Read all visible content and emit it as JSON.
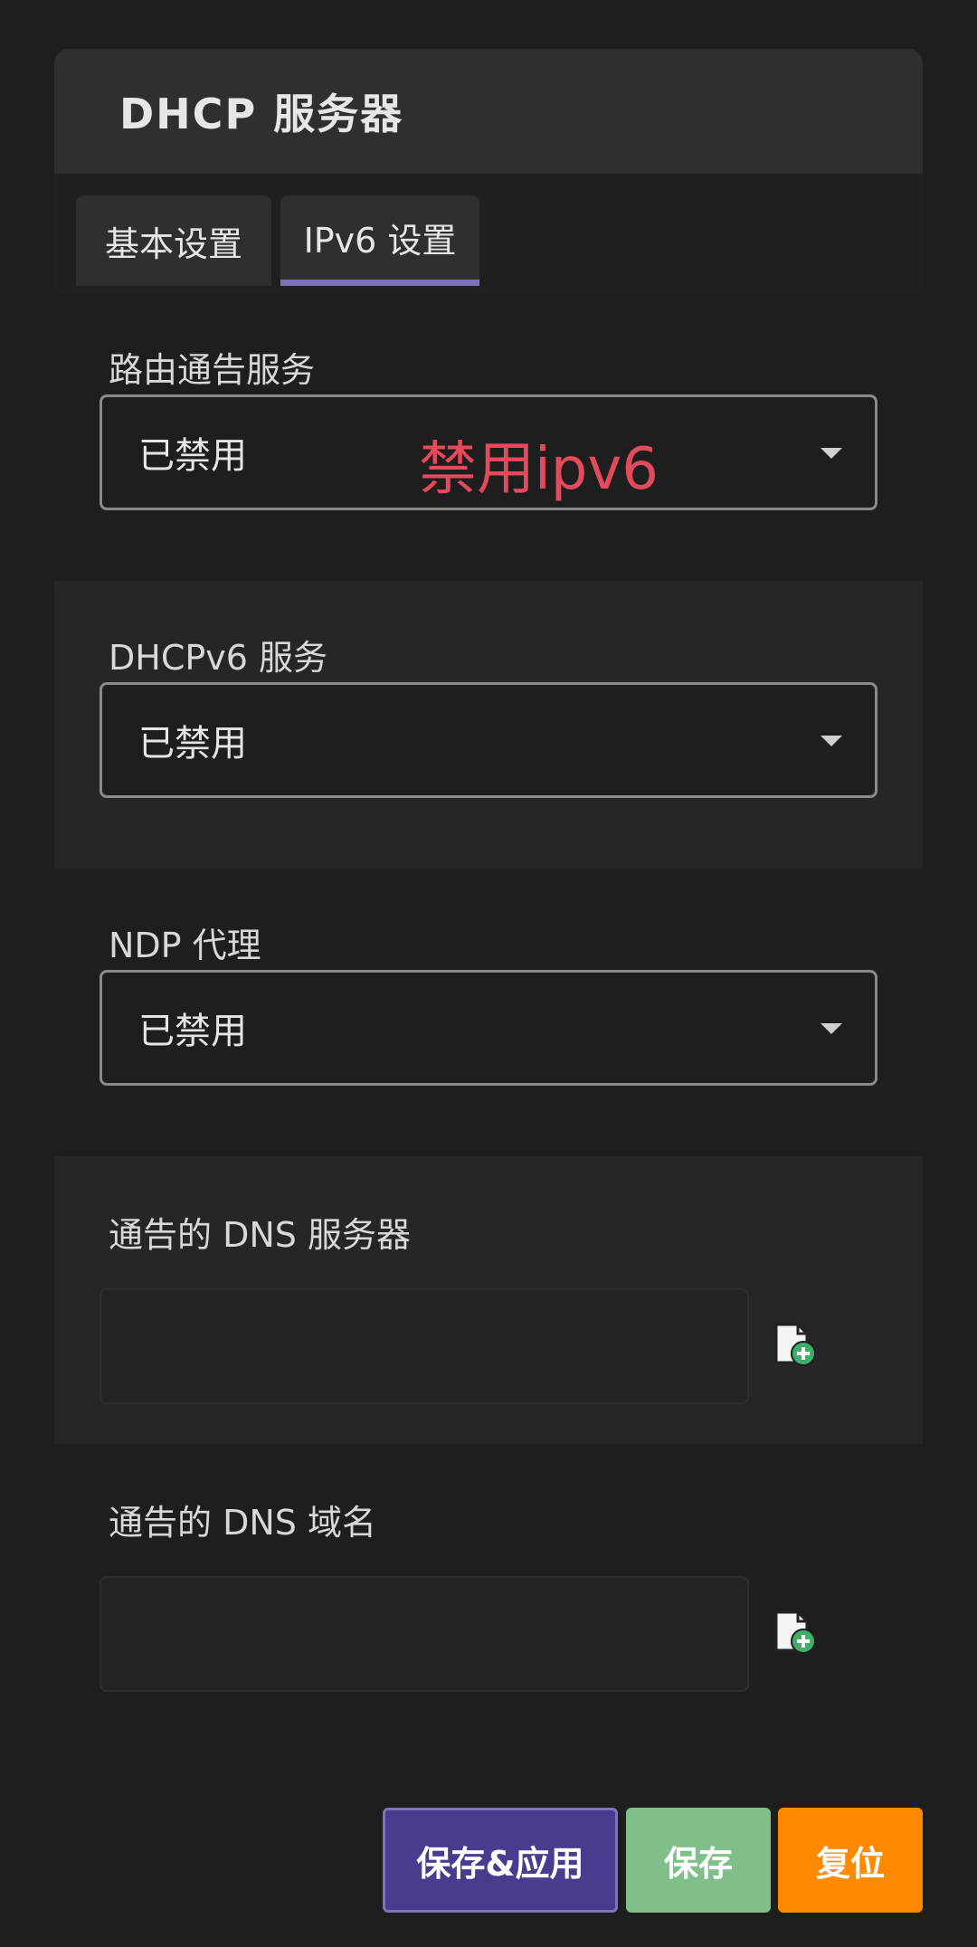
{
  "header": {
    "title": "DHCP 服务器"
  },
  "tabs": [
    {
      "label": "基本设置"
    },
    {
      "label": "IPv6 设置"
    }
  ],
  "fields": {
    "ra": {
      "label": "路由通告服务",
      "value": "已禁用",
      "annotation": "禁用ipv6"
    },
    "dhcpv6": {
      "label": "DHCPv6 服务",
      "value": "已禁用"
    },
    "ndp": {
      "label": "NDP 代理",
      "value": "已禁用"
    },
    "dns_servers": {
      "label": "通告的 DNS 服务器",
      "value": ""
    },
    "dns_domains": {
      "label": "通告的 DNS 域名",
      "value": ""
    }
  },
  "buttons": {
    "save_apply": "保存&应用",
    "save": "保存",
    "reset": "复位"
  },
  "colors": {
    "accent_tab": "#7d73b6",
    "annotation": "#e34a5b",
    "save_apply": "#4b3b8f",
    "save": "#7fc08a",
    "reset": "#ff8a00"
  },
  "icons": {
    "add": "document-add-icon"
  }
}
